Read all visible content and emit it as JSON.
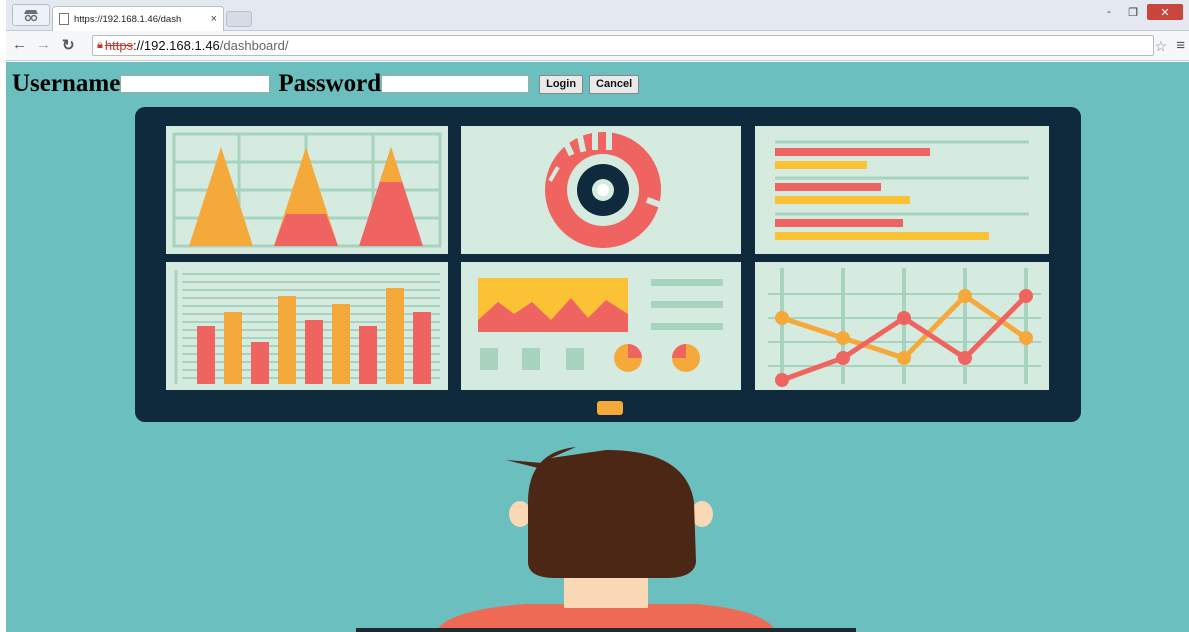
{
  "browser": {
    "tab_title": "https://192.168.1.46/dash",
    "tab_close": "×",
    "url_scheme": "https",
    "url_host": "://192.168.1.46",
    "url_path": "/dashboard/",
    "minimize_glyph": "-",
    "restore_glyph": "❐",
    "close_glyph": "✕"
  },
  "login_form": {
    "username_label": "Username",
    "username_value": "",
    "password_label": "Password",
    "password_value": "",
    "login_button": "Login",
    "cancel_button": "Cancel"
  },
  "illustration": {
    "colors": {
      "background": "#6bbfbe",
      "monitor": "#0f2a3d",
      "panel": "#d5ebe0",
      "grid": "#a8d3be",
      "red": "#ef6461",
      "orange": "#f6a93b",
      "yellow": "#fcc235",
      "hair": "#4d2715",
      "skin": "#f9d8b6",
      "shirt": "#ef6a55"
    },
    "icons": [
      "triangle-chart-icon",
      "donut-chart-icon",
      "horizontal-bar-chart-icon",
      "bar-chart-icon",
      "area-chart-icon",
      "line-chart-icon",
      "person-icon"
    ]
  }
}
